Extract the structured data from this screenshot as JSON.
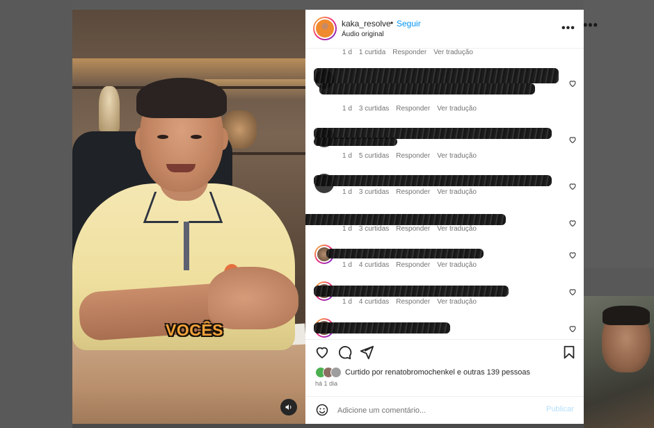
{
  "post": {
    "username": "kaka_resolve",
    "separator": "•",
    "follow_label": "Seguir",
    "audio_label": "Áudio original",
    "more_label": "•••",
    "video_caption": "VOCÊS"
  },
  "background": {
    "more_label": "•••"
  },
  "comments": [
    {
      "time": "1 d",
      "likes": "1 curtida",
      "reply": "Responder",
      "translate": "Ver tradução"
    },
    {
      "time": "1 d",
      "likes": "3 curtidas",
      "reply": "Responder",
      "translate": "Ver tradução"
    },
    {
      "time": "1 d",
      "likes": "5 curtidas",
      "reply": "Responder",
      "translate": "Ver tradução"
    },
    {
      "time": "1 d",
      "likes": "3 curtidas",
      "reply": "Responder",
      "translate": "Ver tradução"
    },
    {
      "time": "1 d",
      "likes": "3 curtidas",
      "reply": "Responder",
      "translate": "Ver tradução"
    },
    {
      "time": "1 d",
      "likes": "4 curtidas",
      "reply": "Responder",
      "translate": "Ver tradução"
    },
    {
      "time": "1 d",
      "likes": "4 curtidas",
      "reply": "Responder",
      "translate": "Ver tradução"
    }
  ],
  "likes_summary": {
    "prefix": "Curtido por",
    "user": "renatobromochenkel",
    "suffix": "e outras 139 pessoas"
  },
  "posted_ago": "há 1 dia",
  "comment_box": {
    "placeholder": "Adicione um comentário...",
    "post_label": "Publicar"
  },
  "colors": {
    "link_blue": "#0095f6",
    "post_disabled": "#b2dffc",
    "caption_orange": "#f3a23a"
  },
  "icons": [
    "heart-icon",
    "comment-icon",
    "share-icon",
    "bookmark-icon",
    "emoji-icon",
    "audio-icon",
    "more-icon"
  ]
}
